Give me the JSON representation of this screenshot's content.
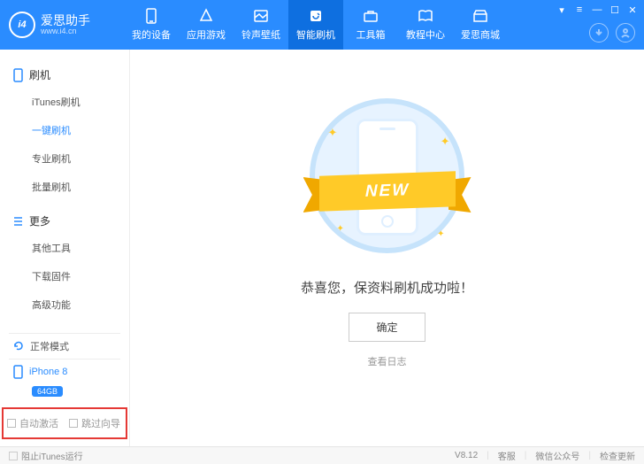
{
  "brand": {
    "name": "爱思助手",
    "url": "www.i4.cn",
    "logo": "i4"
  },
  "nav": [
    {
      "label": "我的设备"
    },
    {
      "label": "应用游戏"
    },
    {
      "label": "铃声壁纸"
    },
    {
      "label": "智能刷机"
    },
    {
      "label": "工具箱"
    },
    {
      "label": "教程中心"
    },
    {
      "label": "爱思商城"
    }
  ],
  "sidebar": {
    "groups": [
      {
        "title": "刷机",
        "items": [
          "iTunes刷机",
          "一键刷机",
          "专业刷机",
          "批量刷机"
        ],
        "active": 1
      },
      {
        "title": "更多",
        "items": [
          "其他工具",
          "下载固件",
          "高级功能"
        ]
      }
    ],
    "mode": "正常模式",
    "device": {
      "name": "iPhone 8",
      "storage": "64GB"
    },
    "options": {
      "auto_activate": "自动激活",
      "skip_guide": "跳过向导"
    }
  },
  "main": {
    "ribbon": "NEW",
    "message": "恭喜您，保资料刷机成功啦！",
    "ok": "确定",
    "log": "查看日志"
  },
  "footer": {
    "block_itunes": "阻止iTunes运行",
    "version": "V8.12",
    "links": [
      "客服",
      "微信公众号",
      "检查更新"
    ]
  }
}
